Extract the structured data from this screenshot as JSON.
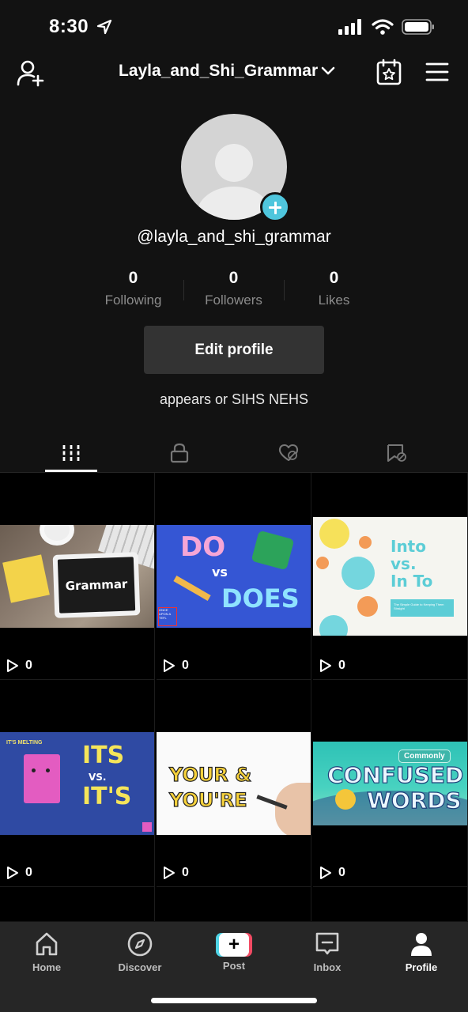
{
  "status_bar": {
    "time": "8:30"
  },
  "header": {
    "username": "Layla_and_Shi_Grammar"
  },
  "profile": {
    "handle": "@layla_and_shi_grammar",
    "stats": [
      {
        "value": "0",
        "label": "Following"
      },
      {
        "value": "0",
        "label": "Followers"
      },
      {
        "value": "0",
        "label": "Likes"
      }
    ],
    "edit_label": "Edit profile",
    "bio": "appears or SIHS NEHS"
  },
  "videos": [
    {
      "thumb_text": "Grammar",
      "views": "0"
    },
    {
      "thumb_text_1": "DO",
      "thumb_text_2": "vs",
      "thumb_text_3": "DOES",
      "thumb_small": "ONCE UPON A TEFL",
      "views": "0"
    },
    {
      "thumb_text_1": "Into",
      "thumb_text_2": "vs.",
      "thumb_text_3": "In To",
      "thumb_small": "The Simple Guide to Keeping Them Straight",
      "views": "0"
    },
    {
      "thumb_text_1": "ITS",
      "thumb_text_2": "VS.",
      "thumb_text_3": "IT'S",
      "thumb_small": "IT'S MELTING",
      "views": "0"
    },
    {
      "thumb_text_1": "YOUR &",
      "thumb_text_2": "YOU'RE",
      "views": "0"
    },
    {
      "thumb_tag": "Commonly",
      "thumb_text_1": "CONFUSED",
      "thumb_text_2": "WORDS",
      "views": "0"
    }
  ],
  "bottom_nav": [
    {
      "label": "Home",
      "icon": "home-icon"
    },
    {
      "label": "Discover",
      "icon": "compass-icon"
    },
    {
      "label": "Post",
      "icon": "plus-icon"
    },
    {
      "label": "Inbox",
      "icon": "message-icon"
    },
    {
      "label": "Profile",
      "icon": "person-icon"
    }
  ],
  "colors": {
    "background": "#121212",
    "accent_cyan": "#4fc6dd",
    "accent_red": "#f24a63",
    "button": "#333333"
  }
}
